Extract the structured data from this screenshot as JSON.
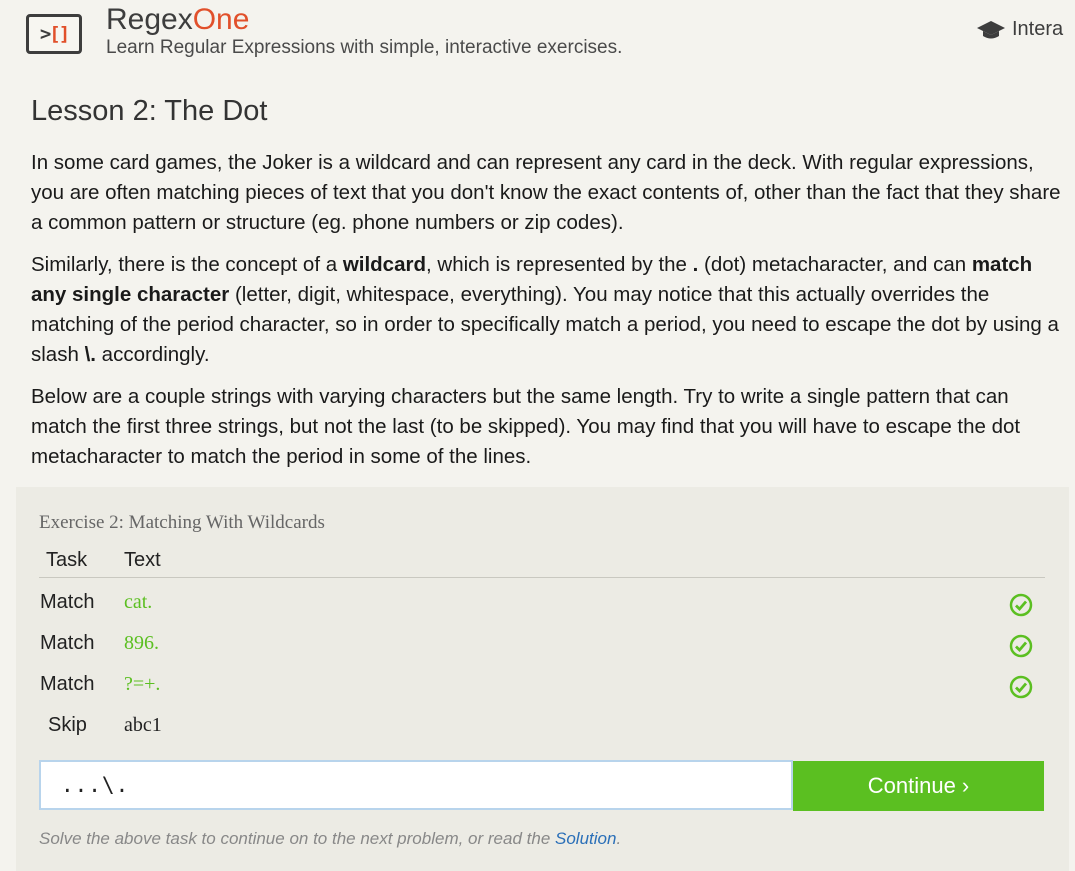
{
  "header": {
    "logo_glyph_left": ">",
    "logo_glyph_right": "[]",
    "title_part1": "Regex",
    "title_part2": "One",
    "tagline": "Learn Regular Expressions with simple, interactive exercises.",
    "nav_link": "Intera"
  },
  "lesson": {
    "title": "Lesson 2: The Dot",
    "p1": "In some card games, the Joker is a wildcard and can represent any card in the deck. With regular expressions, you are often matching pieces of text that you don't know the exact contents of, other than the fact that they share a common pattern or structure (eg. phone numbers or zip codes).",
    "p2_a": "Similarly, there is the concept of a ",
    "p2_b": "wildcard",
    "p2_c": ", which is represented by the ",
    "p2_d": ".",
    "p2_e": " (dot) metacharacter, and can ",
    "p2_f": "match any single character",
    "p2_g": " (letter, digit, whitespace, everything). You may notice that this actually overrides the matching of the period character, so in order to specifically match a period, you need to escape the dot by using a slash ",
    "p2_h": "\\.",
    "p2_i": " accordingly.",
    "p3": "Below are a couple strings with varying characters but the same length. Try to write a single pattern that can match the first three strings, but not the last (to be skipped). You may find that you will have to escape the dot metacharacter to match the period in some of the lines."
  },
  "exercise": {
    "title": "Exercise 2: Matching With Wildcards",
    "col_task": "Task",
    "col_text": "Text",
    "rows": [
      {
        "task": "Match",
        "text": "cat.",
        "status": "matched"
      },
      {
        "task": "Match",
        "text": "896.",
        "status": "matched"
      },
      {
        "task": "Match",
        "text": "?=+.",
        "status": "matched"
      },
      {
        "task": "Skip",
        "text": "abc1",
        "status": "none"
      }
    ],
    "input_value": "...\\.",
    "continue_label": "Continue ›",
    "hint_prefix": "Solve the above task to continue on to the next problem, or read the ",
    "hint_link": "Solution",
    "hint_suffix": "."
  },
  "colors": {
    "accent_orange": "#e1502b",
    "success_green": "#5bbf21",
    "link_blue": "#2a6fb8"
  },
  "icons": {
    "nav": "graduation-cap-icon",
    "row_status": "check-circle-icon"
  }
}
